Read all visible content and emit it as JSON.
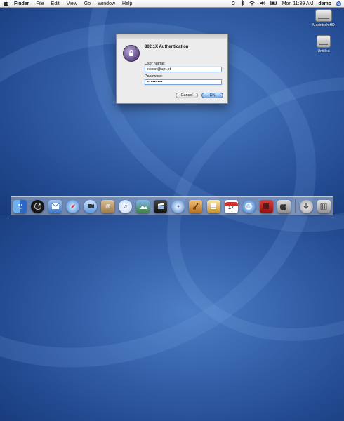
{
  "menubar": {
    "app": "Finder",
    "items": [
      "File",
      "Edit",
      "View",
      "Go",
      "Window",
      "Help"
    ],
    "clock": "Mon 11:39 AM",
    "user": "demo"
  },
  "desktop_icons": [
    {
      "label": "Macintosh HD"
    },
    {
      "label": "Untitled"
    }
  ],
  "dialog": {
    "title": "802.1X Authentication",
    "username_label": "User Name:",
    "username_value": "xxxxx@upt.pt",
    "password_label": "Password:",
    "password_value": "•••••••••",
    "cancel_label": "Cancel",
    "ok_label": "OK"
  },
  "dock": {
    "calendar_day": "17",
    "icons": [
      "finder-icon",
      "dashboard-icon",
      "mail-icon",
      "safari-icon",
      "ichat-icon",
      "address-book-icon",
      "itunes-icon",
      "iphoto-icon",
      "imovie-icon",
      "idvd-icon",
      "garageband-icon",
      "iweb-icon",
      "ical-icon",
      "sync-icon",
      "photo-booth-icon",
      "system-preferences-icon",
      "downloads-stack-icon",
      "trash-icon"
    ]
  },
  "colors": {
    "desktop": "#3865ad",
    "menubar": "#e6e6e6",
    "ok_button": "#6fa6e3"
  }
}
